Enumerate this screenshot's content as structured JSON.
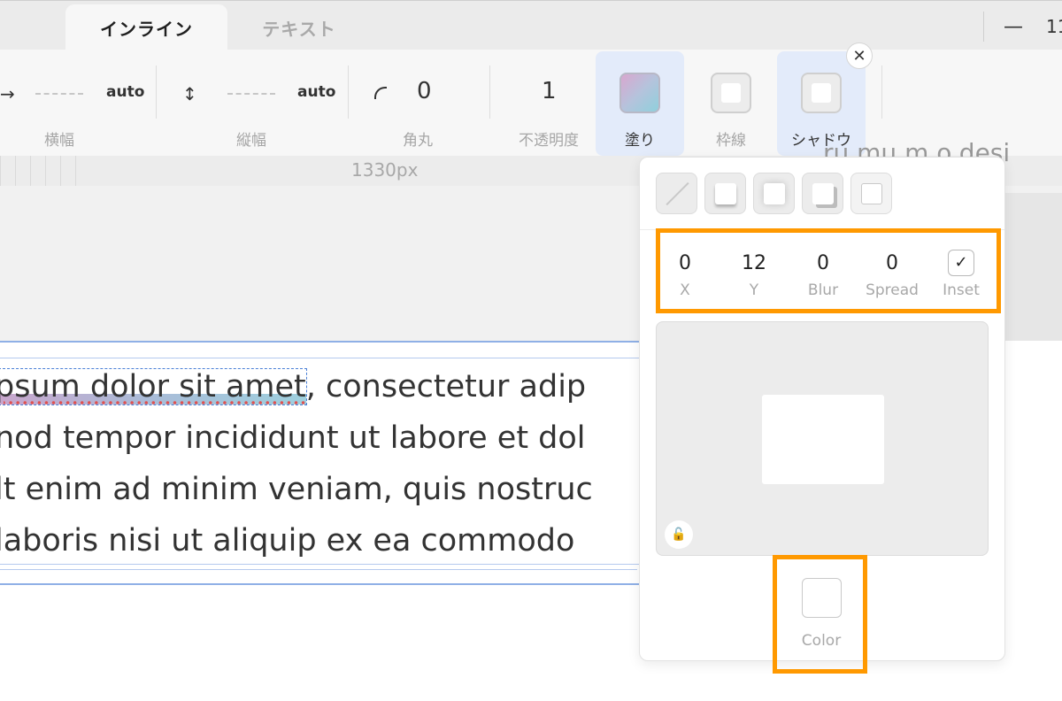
{
  "tabs": {
    "inline": "インライン",
    "text": "テキスト"
  },
  "window": {
    "minimize": "—",
    "partial_number": "11"
  },
  "toolbar": {
    "width": {
      "arrow": "→",
      "placeholder": "----",
      "mode": "auto",
      "label": "横幅"
    },
    "height": {
      "arrow": "↕",
      "placeholder": "----",
      "mode": "auto",
      "label": "縦幅"
    },
    "radius": {
      "value": "0",
      "label": "角丸"
    },
    "opacity": {
      "value": "1",
      "label": "不透明度"
    },
    "fill": {
      "label": "塗り"
    },
    "border": {
      "label": "枠線"
    },
    "shadow": {
      "label": "シャドウ"
    },
    "close": "✕"
  },
  "canvas": {
    "ruler_label": "1330px",
    "url_fragment": "ru.mu.m.o.desi",
    "text_lines": [
      {
        "selected": "psum dolor sit amet",
        "rest": ", consectetur adip"
      },
      {
        "selected": "",
        "rest": "nod tempor incididunt ut labore et dol"
      },
      {
        "selected": "",
        "rest": "lt enim ad minim veniam, quis nostruc"
      },
      {
        "selected": "",
        "rest": "laboris nisi ut aliquip ex ea commodo"
      }
    ]
  },
  "shadow_panel": {
    "fields": {
      "x": {
        "value": "0",
        "label": "X"
      },
      "y": {
        "value": "12",
        "label": "Y"
      },
      "blur": {
        "value": "0",
        "label": "Blur"
      },
      "spread": {
        "value": "0",
        "label": "Spread"
      },
      "inset": {
        "checked": "✓",
        "label": "Inset"
      }
    },
    "lock_icon": "🔓",
    "color_label": "Color"
  },
  "colors": {
    "highlight_orange": "#ff9900",
    "selected_button_bg": "#e3ebfa",
    "frame_blue": "#8fb0e6"
  }
}
